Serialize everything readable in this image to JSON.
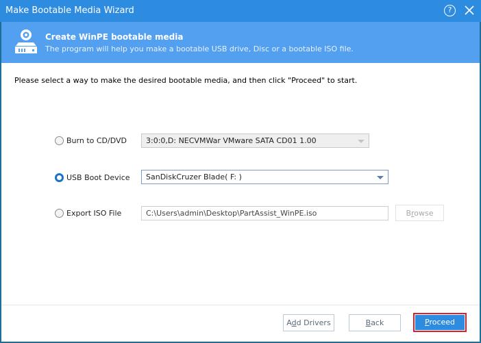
{
  "window": {
    "title": "Make Bootable Media Wizard",
    "help_icon": "help-circle-icon",
    "close_icon": "close-icon"
  },
  "header": {
    "icon": "disc-drive-icon",
    "title": "Create WinPE bootable media",
    "subtitle": "The program will help you make a bootable USB drive, Disc or a bootable ISO file."
  },
  "instruction": "Please select a way to make the desired bootable media, and then click \"Proceed\" to start.",
  "options": [
    {
      "label": "Burn to CD/DVD",
      "selected": false,
      "value": "3:0:0,D: NECVMWar VMware SATA CD01 1.00",
      "control": "dropdown",
      "enabled": false
    },
    {
      "label": "USB Boot Device",
      "selected": true,
      "value": "SanDiskCruzer Blade( F: )",
      "control": "dropdown",
      "enabled": true
    },
    {
      "label": "Export ISO File",
      "selected": false,
      "value": "C:\\Users\\admin\\Desktop\\PartAssist_WinPE.iso",
      "control": "text",
      "enabled": false
    }
  ],
  "browse_button": {
    "prefix": "B",
    "mnemonic": "r",
    "suffix": "owse",
    "enabled": false
  },
  "footer": {
    "add_drivers": {
      "prefix": "A",
      "mnemonic": "d",
      "suffix": "d Drivers"
    },
    "back": {
      "prefix": "",
      "mnemonic": "B",
      "suffix": "ack"
    },
    "proceed": {
      "prefix": "",
      "mnemonic": "P",
      "suffix": "roceed"
    },
    "highlight_color": "#d7212f",
    "accent_color": "#2e8ce0"
  }
}
